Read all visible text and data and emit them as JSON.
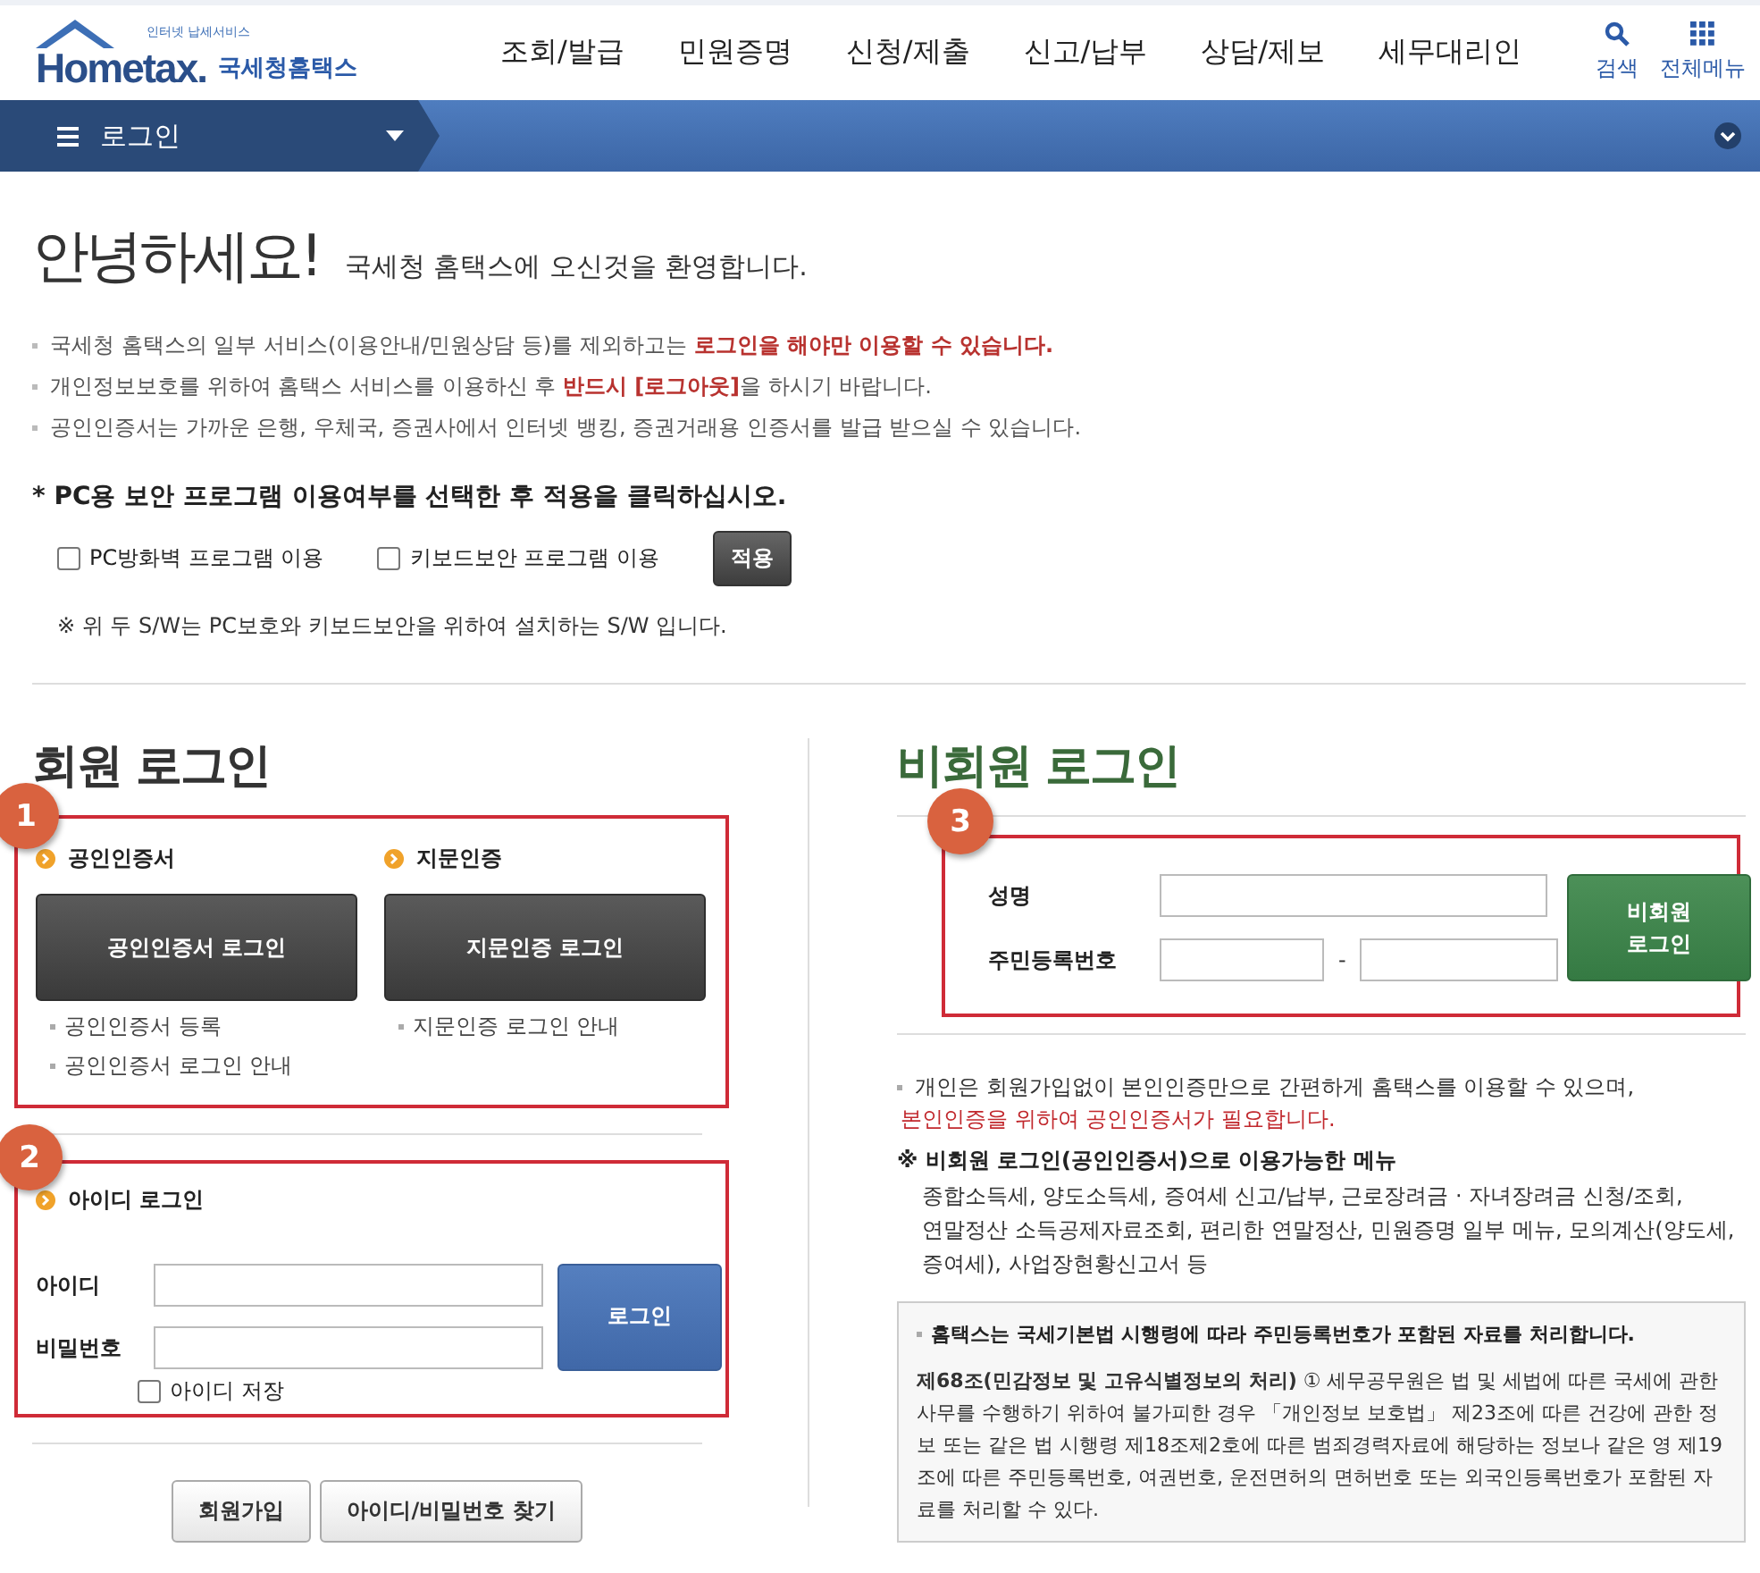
{
  "header": {
    "logo": {
      "tagline": "인터넷 납세서비스",
      "wordmark": "Hometax.",
      "name": "국세청홈택스"
    },
    "nav": [
      "조회/발급",
      "민원증명",
      "신청/제출",
      "신고/납부",
      "상담/제보",
      "세무대리인"
    ],
    "tools": [
      {
        "kind": "search",
        "label": "검색"
      },
      {
        "kind": "menu",
        "label": "전체메뉴"
      }
    ]
  },
  "location_bar": {
    "label": "로그인"
  },
  "greeting": {
    "title": "안녕하세요!",
    "subtitle": "국세청 홈택스에 오신것을 환영합니다."
  },
  "notices": [
    "국세청 홈택스의 일부 서비스(이용안내/민원상담 등)를 제외하고는 **로그인을 해야만 이용할 수 있습니다.**",
    "개인정보보호를 위하여 홈택스 서비스를 이용하신 후 **반드시 [로그아웃]**을 하시기 바랍니다.",
    "공인인증서는 가까운 은행, 우체국, 증권사에서 인터넷 뱅킹, 증권거래용 인증서를 발급 받으실 수 있습니다."
  ],
  "security": {
    "title": "* PC용 보안 프로그램 이용여부를 선택한 후 적용을 클릭하십시오.",
    "options": [
      {
        "label": "PC방화벽 프로그램 이용",
        "checked": false
      },
      {
        "label": "키보드보안 프로그램 이용",
        "checked": false
      }
    ],
    "apply": "적용",
    "note": "※ 위 두 S/W는 PC보호와 키보드보안을 위하여 설치하는 S/W 입니다."
  },
  "member_login": {
    "title": "회원 로그인",
    "cert_section": {
      "badge": "1",
      "methods": [
        {
          "heading": "공인인증서",
          "button": "공인인증서 로그인",
          "links": [
            "공인인증서 등록",
            "공인인증서 로그인 안내"
          ]
        },
        {
          "heading": "지문인증",
          "button": "지문인증 로그인",
          "links": [
            "지문인증 로그인 안내"
          ]
        }
      ]
    },
    "id_section": {
      "badge": "2",
      "heading": "아이디 로그인",
      "id_label": "아이디",
      "password_label": "비밀번호",
      "login_button": "로그인",
      "remember": {
        "label": "아이디 저장",
        "checked": false
      }
    },
    "buttons": [
      "회원가입",
      "아이디/비밀번호 찾기"
    ]
  },
  "guest_login": {
    "title": "비회원 로그인",
    "badge": "3",
    "name_label": "성명",
    "rrn_label": "주민등록번호",
    "separator": "-",
    "button": "비회원 로그인",
    "notice": "개인은 회원가입없이 본인인증만으로 간편하게 홈택스를 이용할 수 있으며,",
    "notice_warning": "본인인증을 위하여 공인인증서가 필요합니다.",
    "menu_title": "※ 비회원 로그인(공인인증서)으로 이용가능한 메뉴",
    "menu_text": "종합소득세, 양도소득세, 증여세 신고/납부, 근로장려금 · 자녀장려금 신청/조회, 연말정산 소득공제자료조회, 편리한 연말정산, 민원증명 일부 메뉴, 모의계산(양도세,증여세), 사업장현황신고서 등",
    "privacy": {
      "title": "홈택스는 국세기본법 시행령에 따라 주민등록번호가 포함된 자료를 처리합니다.",
      "body": "**제68조(민감정보 및 고유식별정보의 처리)** ① 세무공무원은 법 및 세법에 따른 국세에 관한 사무를 수행하기 위하여 불가피한 경우 「개인정보 보호법」 제23조에 따른 건강에 관한 정보 또는 같은 법 시행령 제18조제2호에 따른 범죄경력자료에 해당하는 정보나 같은 영 제19조에 따른 주민등록번호, 여권번호, 운전면허의 면허번호 또는 외국인등록번호가 포함된 자료를 처리할 수 있다."
    }
  }
}
